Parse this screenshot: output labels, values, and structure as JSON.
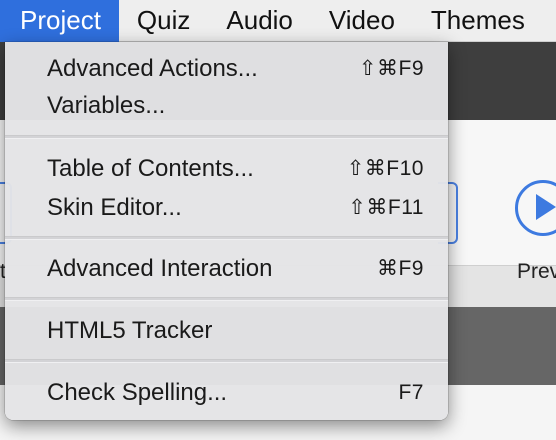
{
  "menubar": {
    "items": [
      {
        "label": "Project",
        "active": true
      },
      {
        "label": "Quiz"
      },
      {
        "label": "Audio"
      },
      {
        "label": "Video"
      },
      {
        "label": "Themes"
      }
    ]
  },
  "background": {
    "preview_label": "Prev",
    "left_letter": "t"
  },
  "menu": {
    "groups": [
      [
        {
          "label": "Advanced Actions...",
          "shortcut": "⇧⌘F9"
        },
        {
          "label": "Variables...",
          "shortcut": ""
        }
      ],
      [
        {
          "label": "Table of Contents...",
          "shortcut": "⇧⌘F10"
        },
        {
          "label": "Skin Editor...",
          "shortcut": "⇧⌘F11"
        }
      ],
      [
        {
          "label": "Advanced Interaction",
          "shortcut": "⌘F9"
        }
      ],
      [
        {
          "label": "HTML5 Tracker",
          "shortcut": ""
        }
      ],
      [
        {
          "label": "Check Spelling...",
          "shortcut": "F7"
        }
      ]
    ]
  },
  "colors": {
    "accent": "#2f6fdd",
    "preview_blue": "#3d7ae0"
  }
}
